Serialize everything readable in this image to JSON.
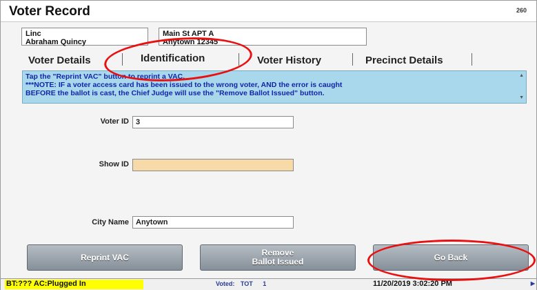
{
  "window": {
    "title": "Voter Record",
    "code": "260"
  },
  "voter": {
    "first_name": "Linc",
    "full_name": "Abraham Quincy",
    "address_line1": "Main St APT A",
    "address_line2": "Anytown 12345"
  },
  "tabs": [
    {
      "label": "Voter Details"
    },
    {
      "label": "Identification",
      "active": true
    },
    {
      "label": "Voter History"
    },
    {
      "label": "Precinct Details"
    }
  ],
  "message": {
    "line1": "Tap the \"Reprint VAC\" button to reprint a VAC.",
    "line2": "***NOTE: IF a voter access card has been issued to the wrong voter, AND the error is caught",
    "line3": "BEFORE the ballot is cast, the Chief Judge will use the \"Remove Ballot Issued\" button."
  },
  "fields": {
    "voter_id": {
      "label": "Voter ID",
      "value": "3"
    },
    "show_id": {
      "label": "Show ID",
      "value": ""
    },
    "city_name": {
      "label": "City Name",
      "value": "Anytown"
    }
  },
  "buttons": {
    "reprint": "Reprint VAC",
    "remove_line1": "Remove",
    "remove_line2": "Ballot Issued",
    "go_back": "Go Back"
  },
  "status": {
    "left": "BT:??? AC:Plugged In",
    "voted_label": "Voted:",
    "voted_value": "TOT",
    "voted_count": "1",
    "datetime": "11/20/2019 3:02:20 PM"
  },
  "colors": {
    "message_bg": "#a9d7ec",
    "message_text": "#1226a8",
    "highlight_field": "#f8d9a8",
    "status_warning": "#ffff00",
    "annotation": "#e81010"
  }
}
